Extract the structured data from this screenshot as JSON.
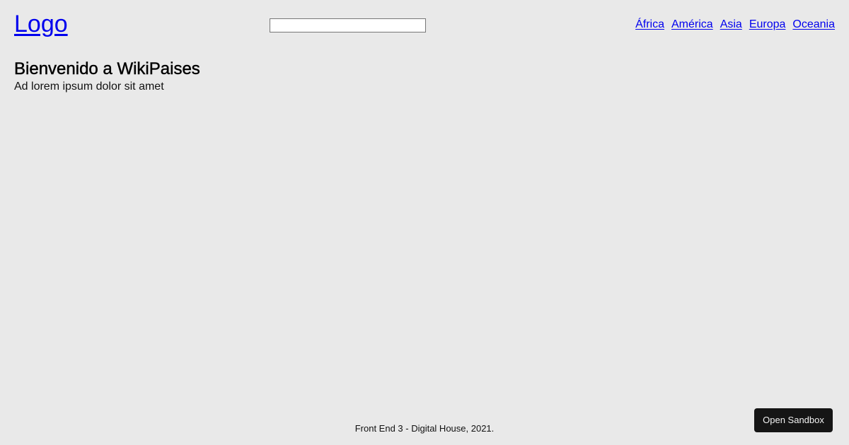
{
  "header": {
    "logo_text": "Logo",
    "search": {
      "value": "",
      "placeholder": ""
    },
    "nav": {
      "items": [
        "África",
        "América",
        "Asia",
        "Europa",
        "Oceania"
      ]
    }
  },
  "main": {
    "title": "Bienvenido a WikiPaises",
    "subtitle": "Ad lorem ipsum dolor sit amet"
  },
  "footer": {
    "text": "Front End 3 - Digital House, 2021."
  },
  "sandbox_button": {
    "label": "Open Sandbox"
  },
  "colors": {
    "background": "#e9e9e9",
    "link": "#0000ee",
    "button_bg": "#151515",
    "button_text": "#f2f2f2"
  }
}
